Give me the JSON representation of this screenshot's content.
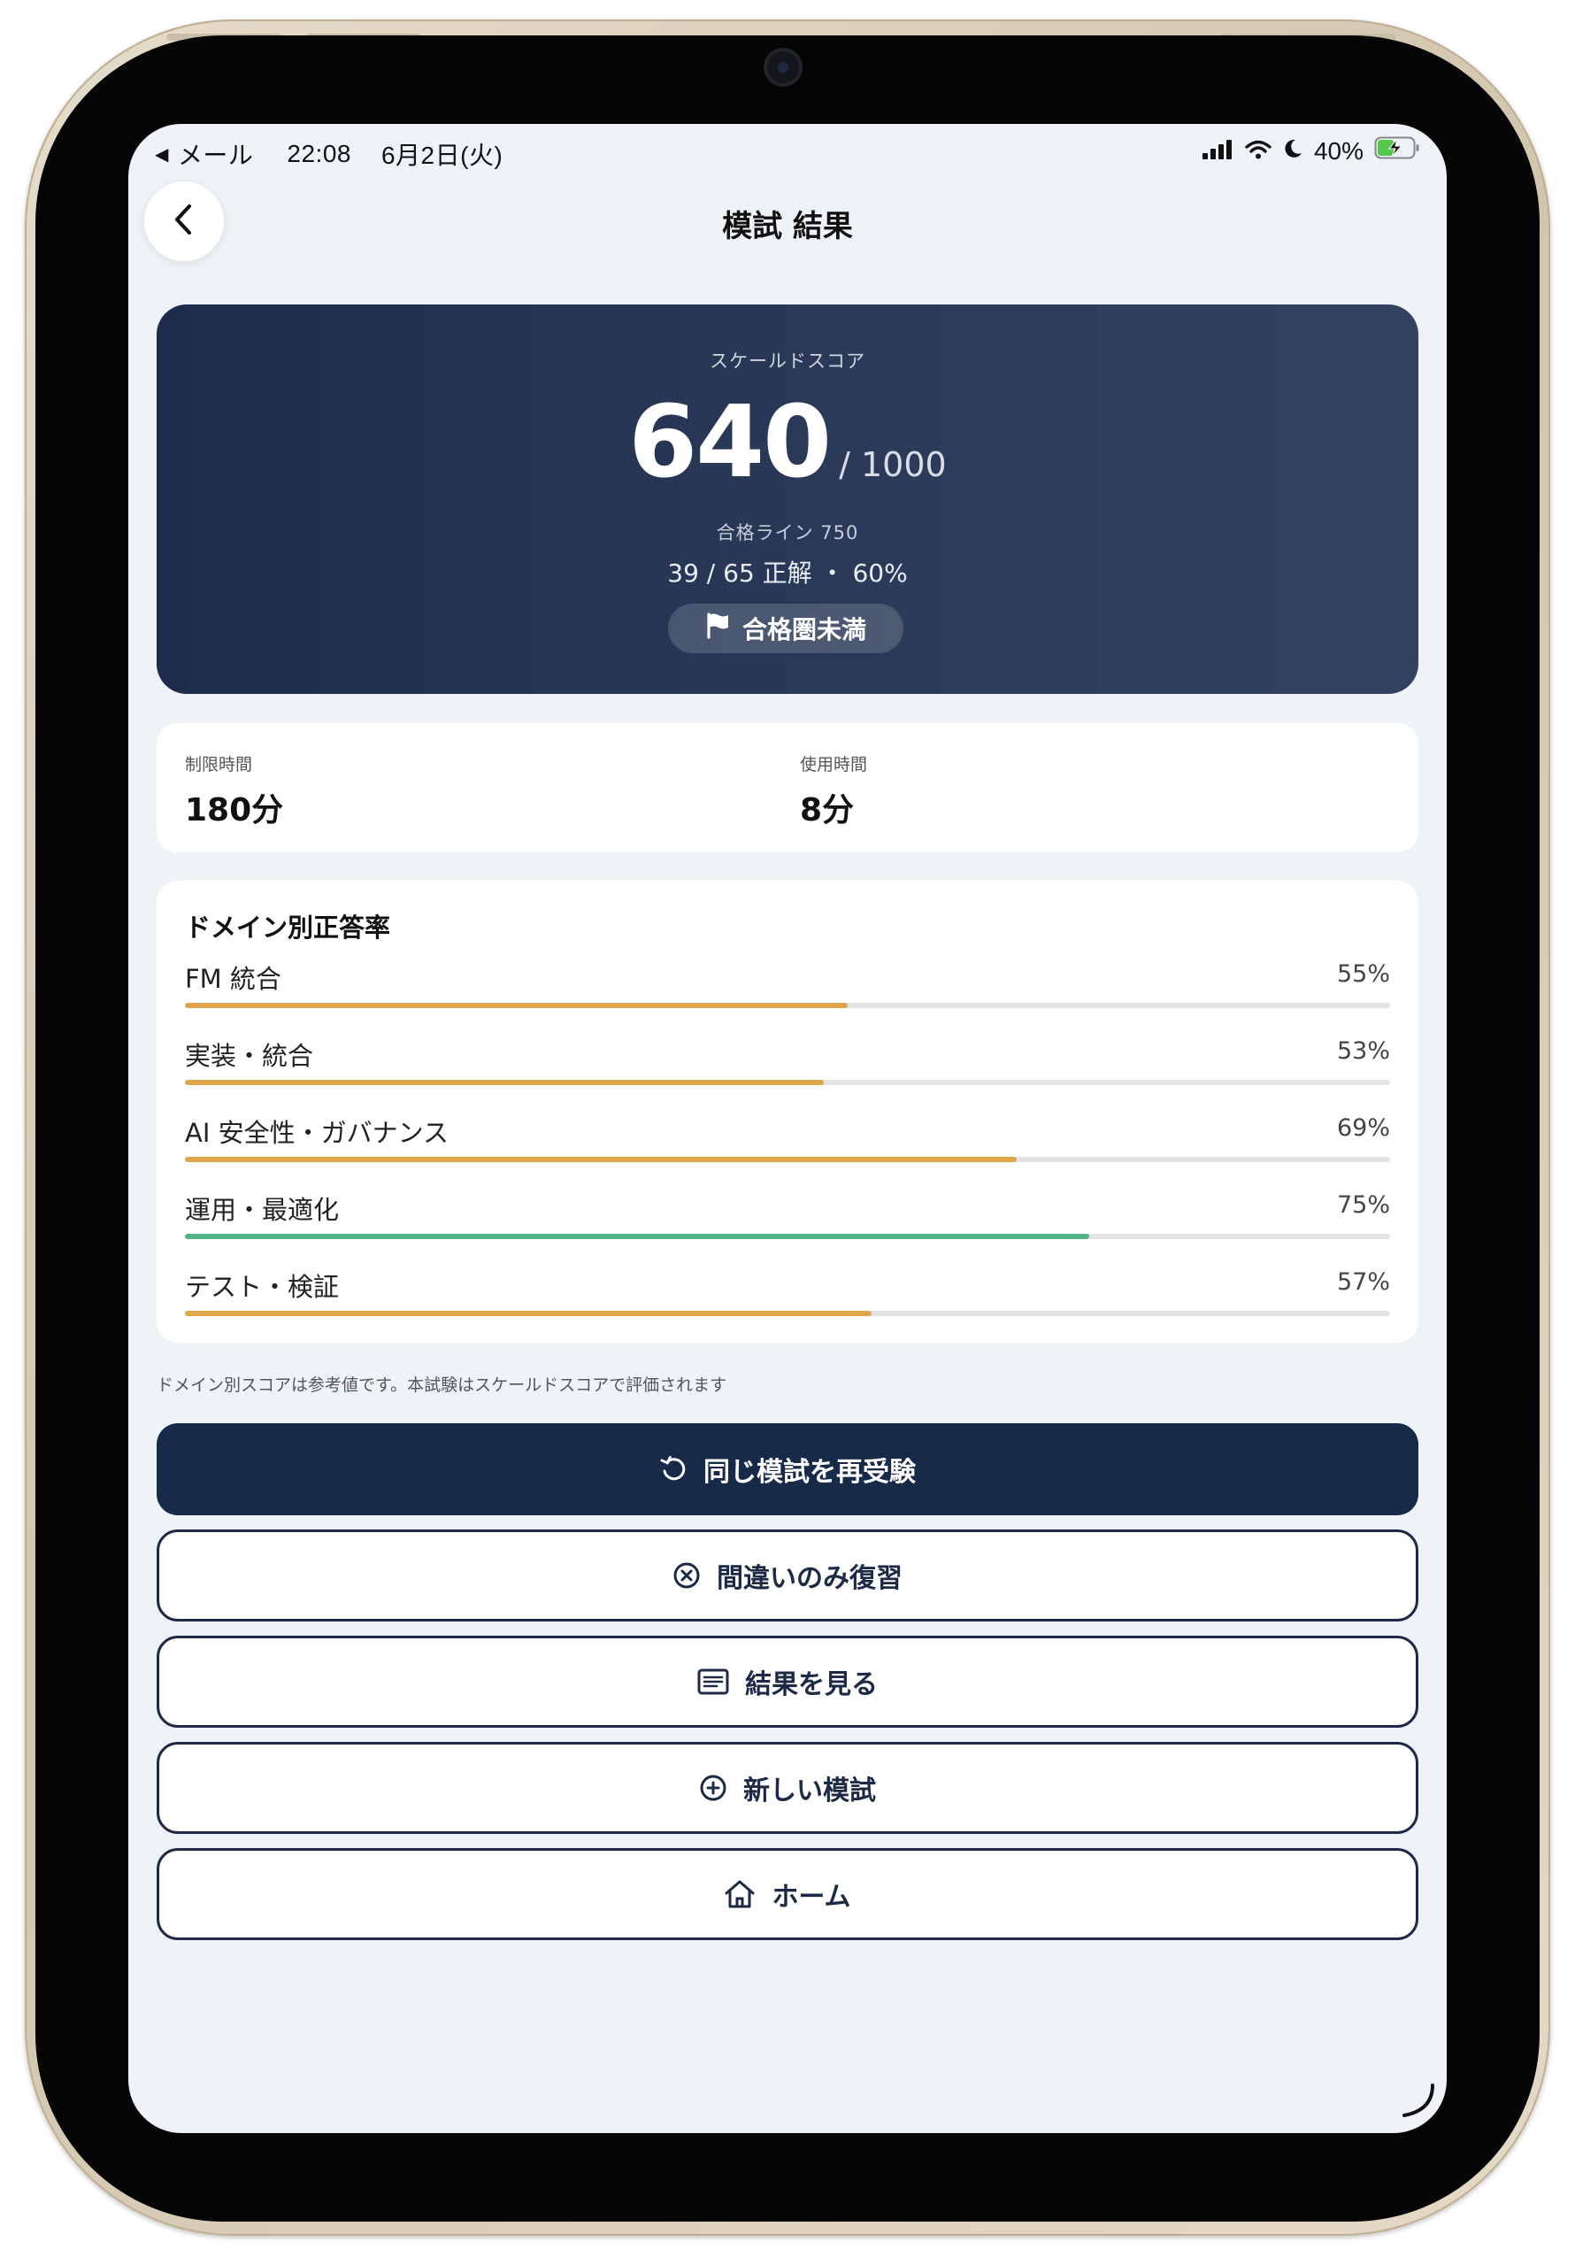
{
  "status_bar": {
    "back_app": "メール",
    "time": "22:08",
    "date": "6月2日(火)",
    "battery": "40%"
  },
  "header": {
    "title": "模試 結果"
  },
  "score": {
    "label": "スケールドスコア",
    "value": "640",
    "max": "/ 1000",
    "pass_line": "合格ライン 750",
    "correct_summary": "39 / 65 正解 ・ 60%",
    "status": "合格圏未満"
  },
  "time": {
    "limit_label": "制限時間",
    "limit_value": "180分",
    "used_label": "使用時間",
    "used_value": "8分"
  },
  "domains": {
    "title": "ドメイン別正答率",
    "items": [
      {
        "name": "FM 統合",
        "percent_label": "55%",
        "percent": 55,
        "color": "#dfa64b"
      },
      {
        "name": "実装・統合",
        "percent_label": "53%",
        "percent": 53,
        "color": "#dfa64b"
      },
      {
        "name": "AI 安全性・ガバナンス",
        "percent_label": "69%",
        "percent": 69,
        "color": "#dfa64b"
      },
      {
        "name": "運用・最適化",
        "percent_label": "75%",
        "percent": 75,
        "color": "#52b485"
      },
      {
        "name": "テスト・検証",
        "percent_label": "57%",
        "percent": 57,
        "color": "#dfa64b"
      }
    ]
  },
  "footnote": "ドメイン別スコアは参考値です。本試験はスケールドスコアで評価されます",
  "actions": {
    "retake": {
      "label": "同じ模試を再受験",
      "icon": "retry-icon"
    },
    "review_wrong": {
      "label": "間違いのみ復習",
      "icon": "x-circle-icon"
    },
    "view_results": {
      "label": "結果を見る",
      "icon": "list-icon"
    },
    "new_exam": {
      "label": "新しい模試",
      "icon": "plus-circle-icon"
    },
    "home": {
      "label": "ホーム",
      "icon": "home-icon"
    }
  },
  "colors": {
    "primary": "#172a48",
    "warning_bar": "#dfa64b",
    "success_bar": "#52b485",
    "background": "#eff2f7"
  }
}
